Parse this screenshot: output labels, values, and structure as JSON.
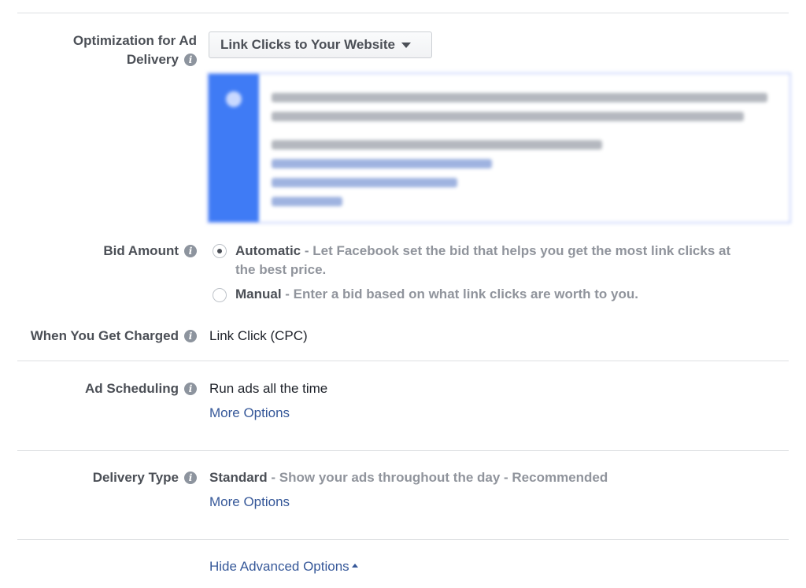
{
  "optimization": {
    "label": "Optimization for Ad Delivery",
    "label_line1": "Optimization for Ad",
    "label_line2": "Delivery",
    "selected": "Link Clicks to Your Website"
  },
  "bid_amount": {
    "label": "Bid Amount",
    "options": [
      {
        "title": "Automatic",
        "desc": " - Let Facebook set the bid that helps you get the most link clicks at",
        "desc2": "the best price.",
        "selected": true
      },
      {
        "title": "Manual",
        "desc": " - Enter a bid based on what link clicks are worth to you.",
        "selected": false
      }
    ]
  },
  "charged": {
    "label": "When You Get Charged",
    "value": "Link Click (CPC)"
  },
  "scheduling": {
    "label": "Ad Scheduling",
    "value": "Run ads all the time",
    "more": "More Options"
  },
  "delivery": {
    "label": "Delivery Type",
    "value": "Standard",
    "desc": " - Show your ads throughout the day - Recommended",
    "more": "More Options"
  },
  "advanced": {
    "toggle": "Hide Advanced Options"
  },
  "colors": {
    "accent_blue": "#3f7bf5",
    "link": "#365899",
    "label": "#4b4f56",
    "muted": "#90949c"
  }
}
